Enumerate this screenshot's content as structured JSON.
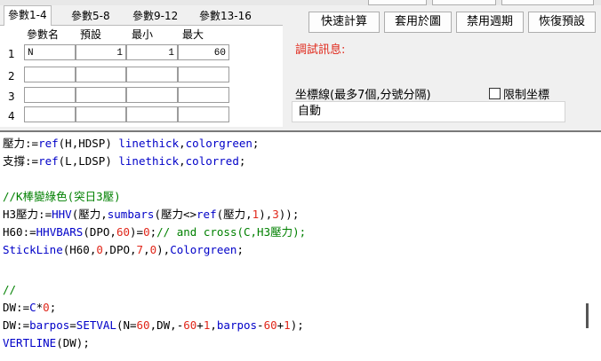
{
  "tabs": [
    "參數1-4",
    "參數5-8",
    "參數9-12",
    "參數13-16"
  ],
  "params": {
    "headers": [
      "參數名",
      "預設",
      "最小",
      "最大"
    ],
    "rows": [
      {
        "num": "1",
        "name": "N",
        "default": "1",
        "min": "1",
        "max": "60"
      },
      {
        "num": "2",
        "name": "",
        "default": "",
        "min": "",
        "max": ""
      },
      {
        "num": "3",
        "name": "",
        "default": "",
        "min": "",
        "max": ""
      },
      {
        "num": "4",
        "name": "",
        "default": "",
        "min": "",
        "max": ""
      }
    ]
  },
  "buttons": [
    "快速計算",
    "套用於圖",
    "禁用週期",
    "恢復預設"
  ],
  "debug_label": "調試訊息:",
  "coord_label": "坐標線(最多7個,分號分隔)",
  "limit_checkbox": "限制坐標",
  "coord_value": "自動",
  "code": [
    [
      [
        "t",
        "壓力:="
      ],
      [
        "f",
        "ref"
      ],
      [
        "t",
        "(H,HDSP) "
      ],
      [
        "f",
        "linethick"
      ],
      [
        "t",
        ","
      ],
      [
        "f",
        "colorgreen"
      ],
      [
        "t",
        ";"
      ]
    ],
    [
      [
        "t",
        "支撐:="
      ],
      [
        "f",
        "ref"
      ],
      [
        "t",
        "(L,LDSP) "
      ],
      [
        "f",
        "linethick"
      ],
      [
        "t",
        ","
      ],
      [
        "f",
        "colorred"
      ],
      [
        "t",
        ";"
      ]
    ],
    [],
    [
      [
        "c",
        "//K棒變綠色(突日3壓)"
      ]
    ],
    [
      [
        "t",
        "H3壓力:="
      ],
      [
        "f",
        "HHV"
      ],
      [
        "t",
        "(壓力,"
      ],
      [
        "f",
        "sumbars"
      ],
      [
        "t",
        "(壓力<>"
      ],
      [
        "f",
        "ref"
      ],
      [
        "t",
        "(壓力,"
      ],
      [
        "n",
        "1"
      ],
      [
        "t",
        "),"
      ],
      [
        "n",
        "3"
      ],
      [
        "t",
        "));"
      ]
    ],
    [
      [
        "t",
        "H60:="
      ],
      [
        "f",
        "HHVBARS"
      ],
      [
        "t",
        "(DPO,"
      ],
      [
        "n",
        "60"
      ],
      [
        "t",
        ")="
      ],
      [
        "n",
        "0"
      ],
      [
        "t",
        ";"
      ],
      [
        "c",
        "// and cross(C,H3壓力);"
      ]
    ],
    [
      [
        "f",
        "StickLine"
      ],
      [
        "t",
        "(H60,"
      ],
      [
        "n",
        "0"
      ],
      [
        "t",
        ",DPO,"
      ],
      [
        "n",
        "7"
      ],
      [
        "t",
        ","
      ],
      [
        "n",
        "0"
      ],
      [
        "t",
        "),"
      ],
      [
        "f",
        "Colorgreen"
      ],
      [
        "t",
        ";"
      ]
    ],
    [],
    [
      [
        "c",
        "//"
      ]
    ],
    [
      [
        "t",
        "DW:="
      ],
      [
        "f",
        "C"
      ],
      [
        "t",
        "*"
      ],
      [
        "n",
        "0"
      ],
      [
        "t",
        ";"
      ]
    ],
    [
      [
        "t",
        "DW:="
      ],
      [
        "f",
        "barpos"
      ],
      [
        "t",
        "="
      ],
      [
        "f",
        "SETVAL"
      ],
      [
        "t",
        "(N="
      ],
      [
        "n",
        "60"
      ],
      [
        "t",
        ",DW,-"
      ],
      [
        "n",
        "60"
      ],
      [
        "t",
        "+"
      ],
      [
        "n",
        "1"
      ],
      [
        "t",
        ","
      ],
      [
        "f",
        "barpos"
      ],
      [
        "t",
        "-"
      ],
      [
        "n",
        "60"
      ],
      [
        "t",
        "+"
      ],
      [
        "n",
        "1"
      ],
      [
        "t",
        ");"
      ]
    ],
    [
      [
        "f",
        "VERTLINE"
      ],
      [
        "t",
        "(DW);"
      ]
    ]
  ]
}
